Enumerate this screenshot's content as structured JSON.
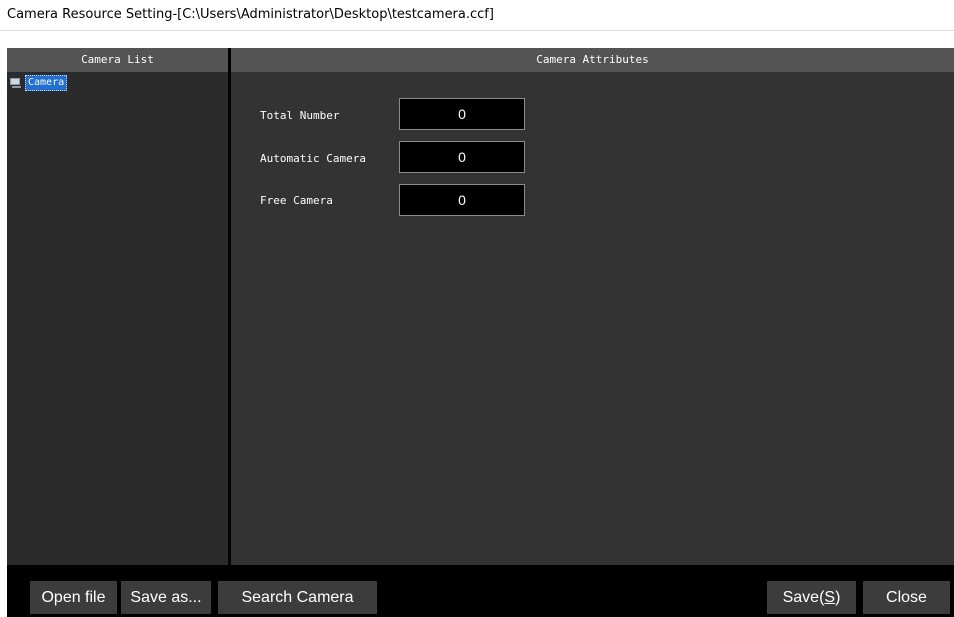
{
  "window": {
    "title": "Camera Resource Setting-[C:\\Users\\Administrator\\Desktop\\testcamera.ccf]"
  },
  "left_panel": {
    "header": "Camera List",
    "tree": [
      {
        "label": "Camera",
        "icon": "camera-group-icon",
        "selected": true
      }
    ]
  },
  "right_panel": {
    "header": "Camera Attributes",
    "fields": [
      {
        "label": "Total Number",
        "value": "0"
      },
      {
        "label": "Automatic Camera",
        "value": "0"
      },
      {
        "label": "Free Camera",
        "value": "0"
      }
    ]
  },
  "buttons": {
    "open_file": "Open file",
    "save_as": "Save as...",
    "search_camera": "Search Camera",
    "save_prefix": "Save(",
    "save_mnemonic": "S",
    "save_suffix": ")",
    "close": "Close"
  },
  "colors": {
    "selection": "#1f6fd6",
    "header_bg": "#545454",
    "pane_bg": "#333333",
    "button_bg": "#3c3c3c"
  }
}
